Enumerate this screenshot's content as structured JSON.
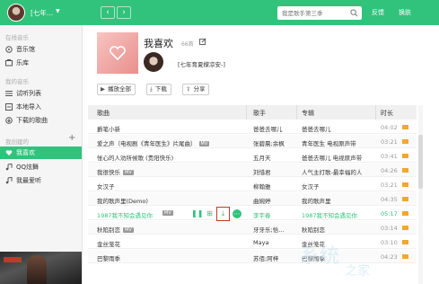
{
  "topbar": {
    "username": "[七年...",
    "search_placeholder": "我是歌手第三季",
    "feedback": "反馈",
    "skin": "换肤",
    "colors": {
      "brand": "#31c27c"
    }
  },
  "sidebar": {
    "section_online": "在线音乐",
    "online_items": [
      {
        "label": "音乐馆",
        "icon": "music-hall-icon"
      },
      {
        "label": "乐库",
        "icon": "library-icon"
      }
    ],
    "section_my": "我的音乐",
    "my_items": [
      {
        "label": "试听列表",
        "icon": "list-icon"
      },
      {
        "label": "本地导入",
        "icon": "folder-icon"
      },
      {
        "label": "下载的歌曲",
        "icon": "download-icon"
      }
    ],
    "section_created": "我创建的",
    "add_label": "+",
    "created_items": [
      {
        "label": "我喜欢",
        "icon": "heart-icon",
        "active": true
      },
      {
        "label": "QQ炫舞",
        "icon": "music-note-icon"
      },
      {
        "label": "我最爱听",
        "icon": "music-note-icon"
      }
    ]
  },
  "playlist": {
    "title": "我喜欢",
    "count": "66首",
    "owner": "[七年育夏檬凉安-]",
    "actions": {
      "play_all": "播放全部",
      "download": "下载",
      "share": "分享"
    }
  },
  "table": {
    "headers": {
      "song": "歌曲",
      "artist": "歌手",
      "album": "专辑",
      "duration": "时长"
    },
    "rows": [
      {
        "song": "爵笔小新",
        "mv": false,
        "artist": "爸爸去哪儿",
        "album": "爸爸去哪儿",
        "duration": "04:02"
      },
      {
        "song": "爱之声（电视剧《青年医生》片尾曲）",
        "mv": true,
        "mv_label": "MV",
        "artist": "张碧晨;余枫",
        "album": "青年医生 电视原声带",
        "duration": "03:21"
      },
      {
        "song": "怅心的人劝所候歌 (贵阳快乐)",
        "mv": false,
        "artist": "五月天",
        "album": "爸爸去哪儿 电视原声带",
        "duration": "03:41"
      },
      {
        "song": "我很快乐",
        "mv": true,
        "mv_label": "MV",
        "artist": "刘惜君",
        "album": "人气主打歌-最幸福的人",
        "duration": "04:26"
      },
      {
        "song": "女汉子",
        "mv": false,
        "artist": "柳翰雅",
        "album": "女汉子",
        "duration": "03:21"
      },
      {
        "song": "我的歌声里(Demo)",
        "mv": false,
        "artist": "曲婉婷",
        "album": "我的歌声里",
        "duration": "04:35"
      },
      {
        "song": "1987我不知会遇见你",
        "mv": true,
        "mv_label": "MV",
        "artist": "李宇春",
        "album": "1987我不知会遇见你",
        "duration": "05:17",
        "playing": true
      },
      {
        "song": "秋陷别恋",
        "mv": true,
        "mv_label": "MV",
        "artist": "牙牙乐;恰...",
        "album": "秋陷别恋",
        "duration": "03:14"
      },
      {
        "song": "金丝笼花",
        "mv": false,
        "artist": "Maya",
        "album": "金丝笼花",
        "duration": "03:10"
      },
      {
        "song": "巴黎雨季",
        "mv": false,
        "artist": "苏佰;阿梓",
        "album": "巴黎雨季",
        "duration": "04:23"
      }
    ]
  }
}
